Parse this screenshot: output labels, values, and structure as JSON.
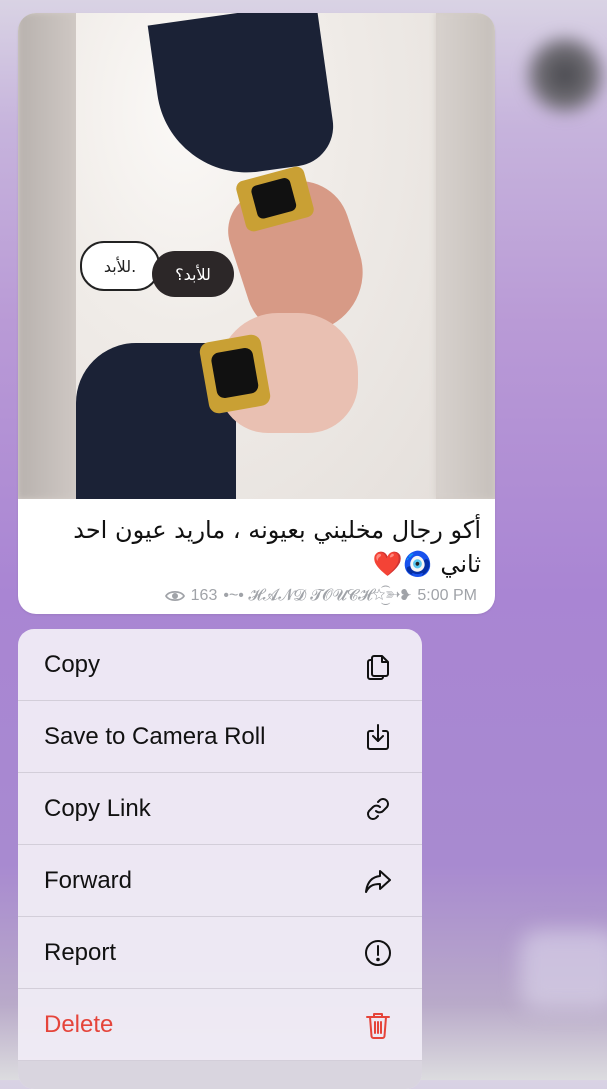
{
  "message": {
    "text": "أكو رجال مخليني بعيونه ، ماريد عيون احد ثاني 🧿❤️",
    "views": "163",
    "signature": "•~• 𝓗𝓐𝓝𝓓 𝓣𝓞𝓤𝓒𝓗☆͜͡➳❥",
    "time": "5:00 PM",
    "image": {
      "bubble_white": "للأبد.",
      "bubble_dark": "للأبد؟"
    }
  },
  "menu": {
    "items": [
      {
        "label": "Copy",
        "icon": "copy-icon"
      },
      {
        "label": "Save to Camera Roll",
        "icon": "save-download-icon"
      },
      {
        "label": "Copy Link",
        "icon": "link-icon"
      },
      {
        "label": "Forward",
        "icon": "forward-arrow-icon"
      },
      {
        "label": "Report",
        "icon": "exclamation-circle-icon"
      },
      {
        "label": "Delete",
        "icon": "trash-icon",
        "color": "#e5443a"
      }
    ]
  }
}
